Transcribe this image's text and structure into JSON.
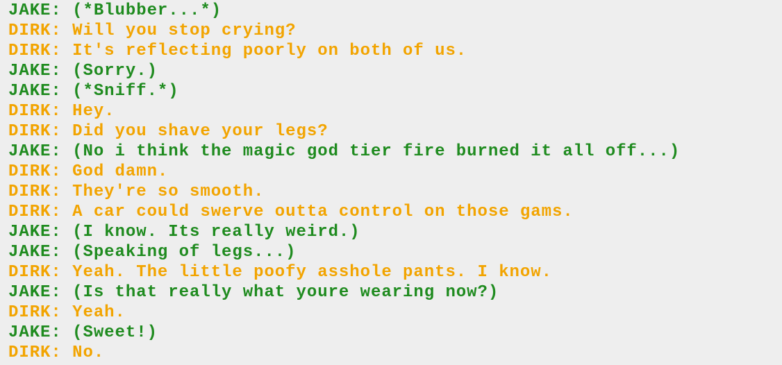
{
  "colors": {
    "jake": "#1f8b1f",
    "dirk": "#f2a400",
    "background": "#eeeeee"
  },
  "log": {
    "lines": [
      {
        "speaker": "jake",
        "text": "JAKE: (*Blubber...*)"
      },
      {
        "speaker": "dirk",
        "text": "DIRK: Will you stop crying?"
      },
      {
        "speaker": "dirk",
        "text": "DIRK: It's reflecting poorly on both of us."
      },
      {
        "speaker": "jake",
        "text": "JAKE: (Sorry.)"
      },
      {
        "speaker": "jake",
        "text": "JAKE: (*Sniff.*)"
      },
      {
        "speaker": "dirk",
        "text": "DIRK: Hey."
      },
      {
        "speaker": "dirk",
        "text": "DIRK: Did you shave your legs?"
      },
      {
        "speaker": "jake",
        "text": "JAKE: (No i think the magic god tier fire burned it all off...)"
      },
      {
        "speaker": "dirk",
        "text": "DIRK: God damn."
      },
      {
        "speaker": "dirk",
        "text": "DIRK: They're so smooth."
      },
      {
        "speaker": "dirk",
        "text": "DIRK: A car could swerve outta control on those gams."
      },
      {
        "speaker": "jake",
        "text": "JAKE: (I know. Its really weird.)"
      },
      {
        "speaker": "jake",
        "text": "JAKE: (Speaking of legs...)"
      },
      {
        "speaker": "dirk",
        "text": "DIRK: Yeah. The little poofy asshole pants. I know."
      },
      {
        "speaker": "jake",
        "text": "JAKE: (Is that really what youre wearing now?)"
      },
      {
        "speaker": "dirk",
        "text": "DIRK: Yeah."
      },
      {
        "speaker": "jake",
        "text": "JAKE: (Sweet!)"
      },
      {
        "speaker": "dirk",
        "text": "DIRK: No."
      }
    ]
  }
}
